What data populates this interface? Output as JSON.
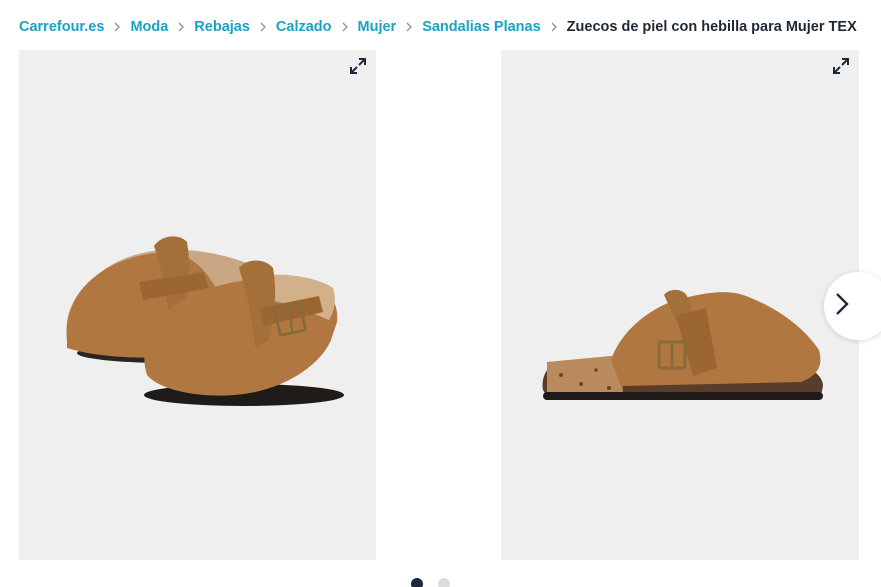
{
  "breadcrumb": {
    "items": [
      {
        "label": "Carrefour.es"
      },
      {
        "label": "Moda"
      },
      {
        "label": "Rebajas"
      },
      {
        "label": "Calzado"
      },
      {
        "label": "Mujer"
      },
      {
        "label": "Sandalias Planas"
      }
    ],
    "current": "Zuecos de piel con hebilla para Mujer TEX"
  },
  "gallery": {
    "images": [
      {
        "icon": "expand-icon",
        "subject": "clogs-pair-angle"
      },
      {
        "icon": "expand-icon",
        "subject": "clog-side-view"
      }
    ],
    "next_icon": "chevron-right-icon",
    "pagination": {
      "total": 2,
      "active": 1
    }
  },
  "colors": {
    "link": "#1aa2c4",
    "text": "#1f2933",
    "image_bg": "#efefef",
    "suede": "#b07840",
    "dot_active": "#1b2a3a",
    "dot_inactive": "#dcdcdc"
  }
}
